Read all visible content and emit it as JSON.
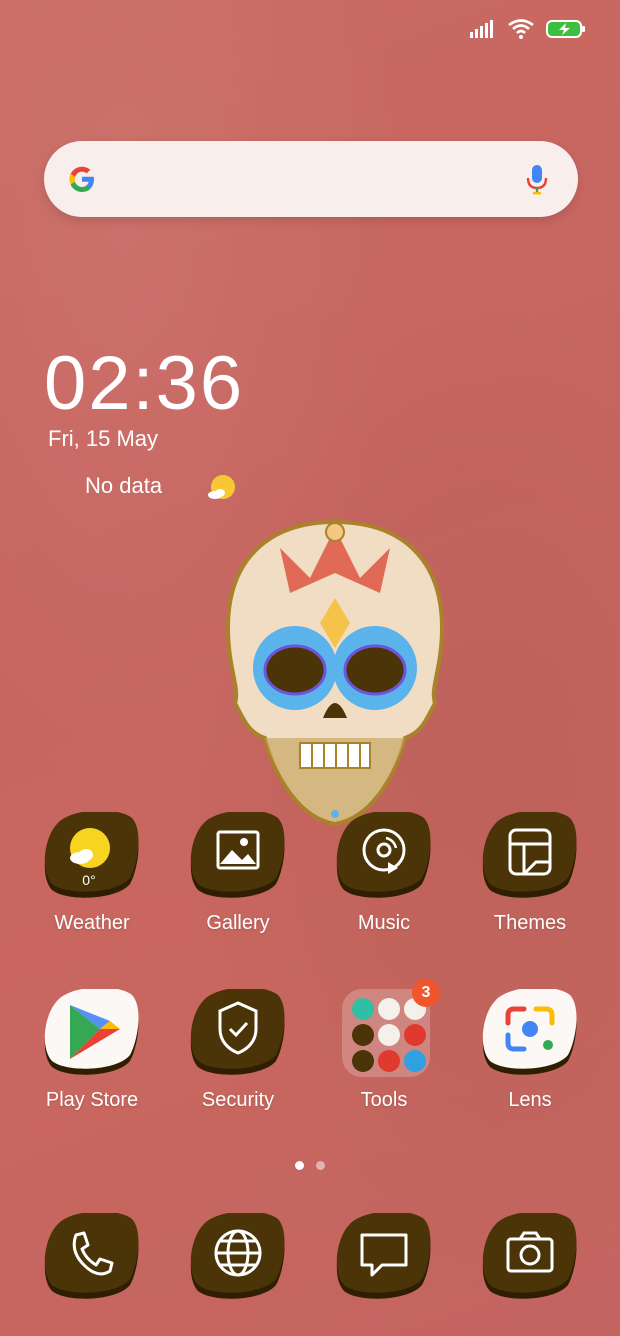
{
  "clock": {
    "time": "02:36",
    "date": "Fri, 15 May"
  },
  "weather_widget": {
    "text": "No data"
  },
  "apps_row1": [
    {
      "label": "Weather",
      "temp": "0°"
    },
    {
      "label": "Gallery"
    },
    {
      "label": "Music"
    },
    {
      "label": "Themes"
    }
  ],
  "apps_row2": [
    {
      "label": "Play Store"
    },
    {
      "label": "Security"
    },
    {
      "label": "Tools",
      "badge": "3"
    },
    {
      "label": "Lens"
    }
  ],
  "dock": [
    {
      "icon": "phone-icon"
    },
    {
      "icon": "browser-icon"
    },
    {
      "icon": "messages-icon"
    },
    {
      "icon": "camera-icon"
    }
  ],
  "pages": {
    "count": 2,
    "current": 1
  },
  "colors": {
    "wallpaper": "#c96a62",
    "icon_blob": "#4a3408",
    "badge": "#f2552c",
    "battery_charging": "#3dbe3d"
  }
}
